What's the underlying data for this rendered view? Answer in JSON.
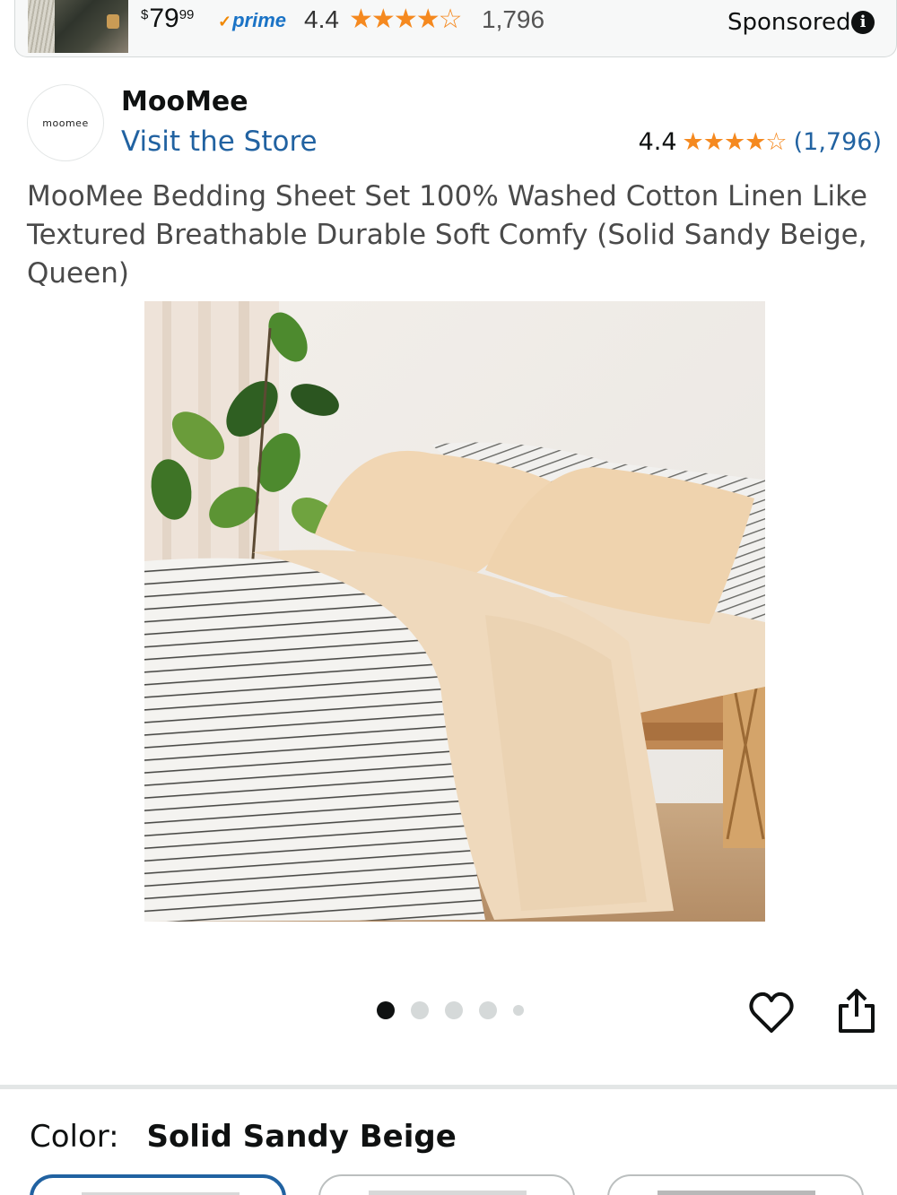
{
  "ad": {
    "price_currency": "$",
    "price_whole": "79",
    "price_fraction": "99",
    "prime_label": "prime",
    "rating": "4.4",
    "review_count": "1,796",
    "sponsored_label": "Sponsored",
    "star_rating_value": 4.4
  },
  "brand": {
    "logo_text": "moomee",
    "name": "MooMee",
    "visit_store": "Visit the Store",
    "rating": "4.4",
    "review_count": "(1,796)",
    "star_rating_value": 4.4
  },
  "product": {
    "title": "MooMee Bedding Sheet Set 100% Washed Cotton Linen Like Textured Breathable Durable Soft Comfy (Solid Sandy Beige, Queen)"
  },
  "carousel": {
    "total_images": 5,
    "active_index": 0
  },
  "color": {
    "label": "Color:",
    "value": "Solid Sandy Beige"
  },
  "colors_accent": {
    "link": "#2162a1",
    "star": "#f5891f",
    "prime": "#1a73c6"
  },
  "icons": [
    "info-icon",
    "star-icon",
    "heart-icon",
    "share-icon"
  ]
}
